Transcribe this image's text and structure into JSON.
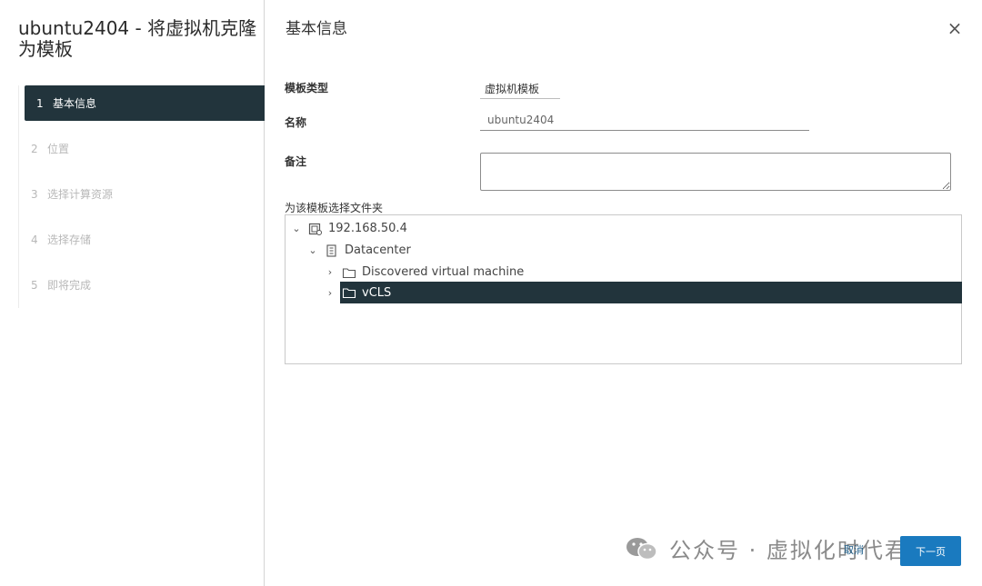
{
  "wizard": {
    "title": "ubuntu2404 - 将虚拟机克隆为模板",
    "steps": [
      {
        "num": "1",
        "label": "基本信息"
      },
      {
        "num": "2",
        "label": "位置"
      },
      {
        "num": "3",
        "label": "选择计算资源"
      },
      {
        "num": "4",
        "label": "选择存储"
      },
      {
        "num": "5",
        "label": "即将完成"
      }
    ]
  },
  "page": {
    "section_title": "基本信息",
    "close_symbol": "×"
  },
  "form": {
    "template_type_label": "模板类型",
    "template_type_value": "虚拟机模板",
    "name_label": "名称",
    "name_value": "ubuntu2404",
    "notes_label": "备注",
    "notes_value": "",
    "folder_label": "为该模板选择文件夹"
  },
  "tree": {
    "host": "192.168.50.4",
    "datacenter": "Datacenter",
    "folders": [
      "Discovered virtual machine",
      "vCLS"
    ],
    "selected": "vCLS"
  },
  "footer": {
    "watermark": "公众号 · 虚拟化时代君",
    "cancel_label": "取消",
    "next_label": "下一页"
  },
  "colors": {
    "selected_bg": "#22343c",
    "primary_button": "#1a7abf"
  }
}
